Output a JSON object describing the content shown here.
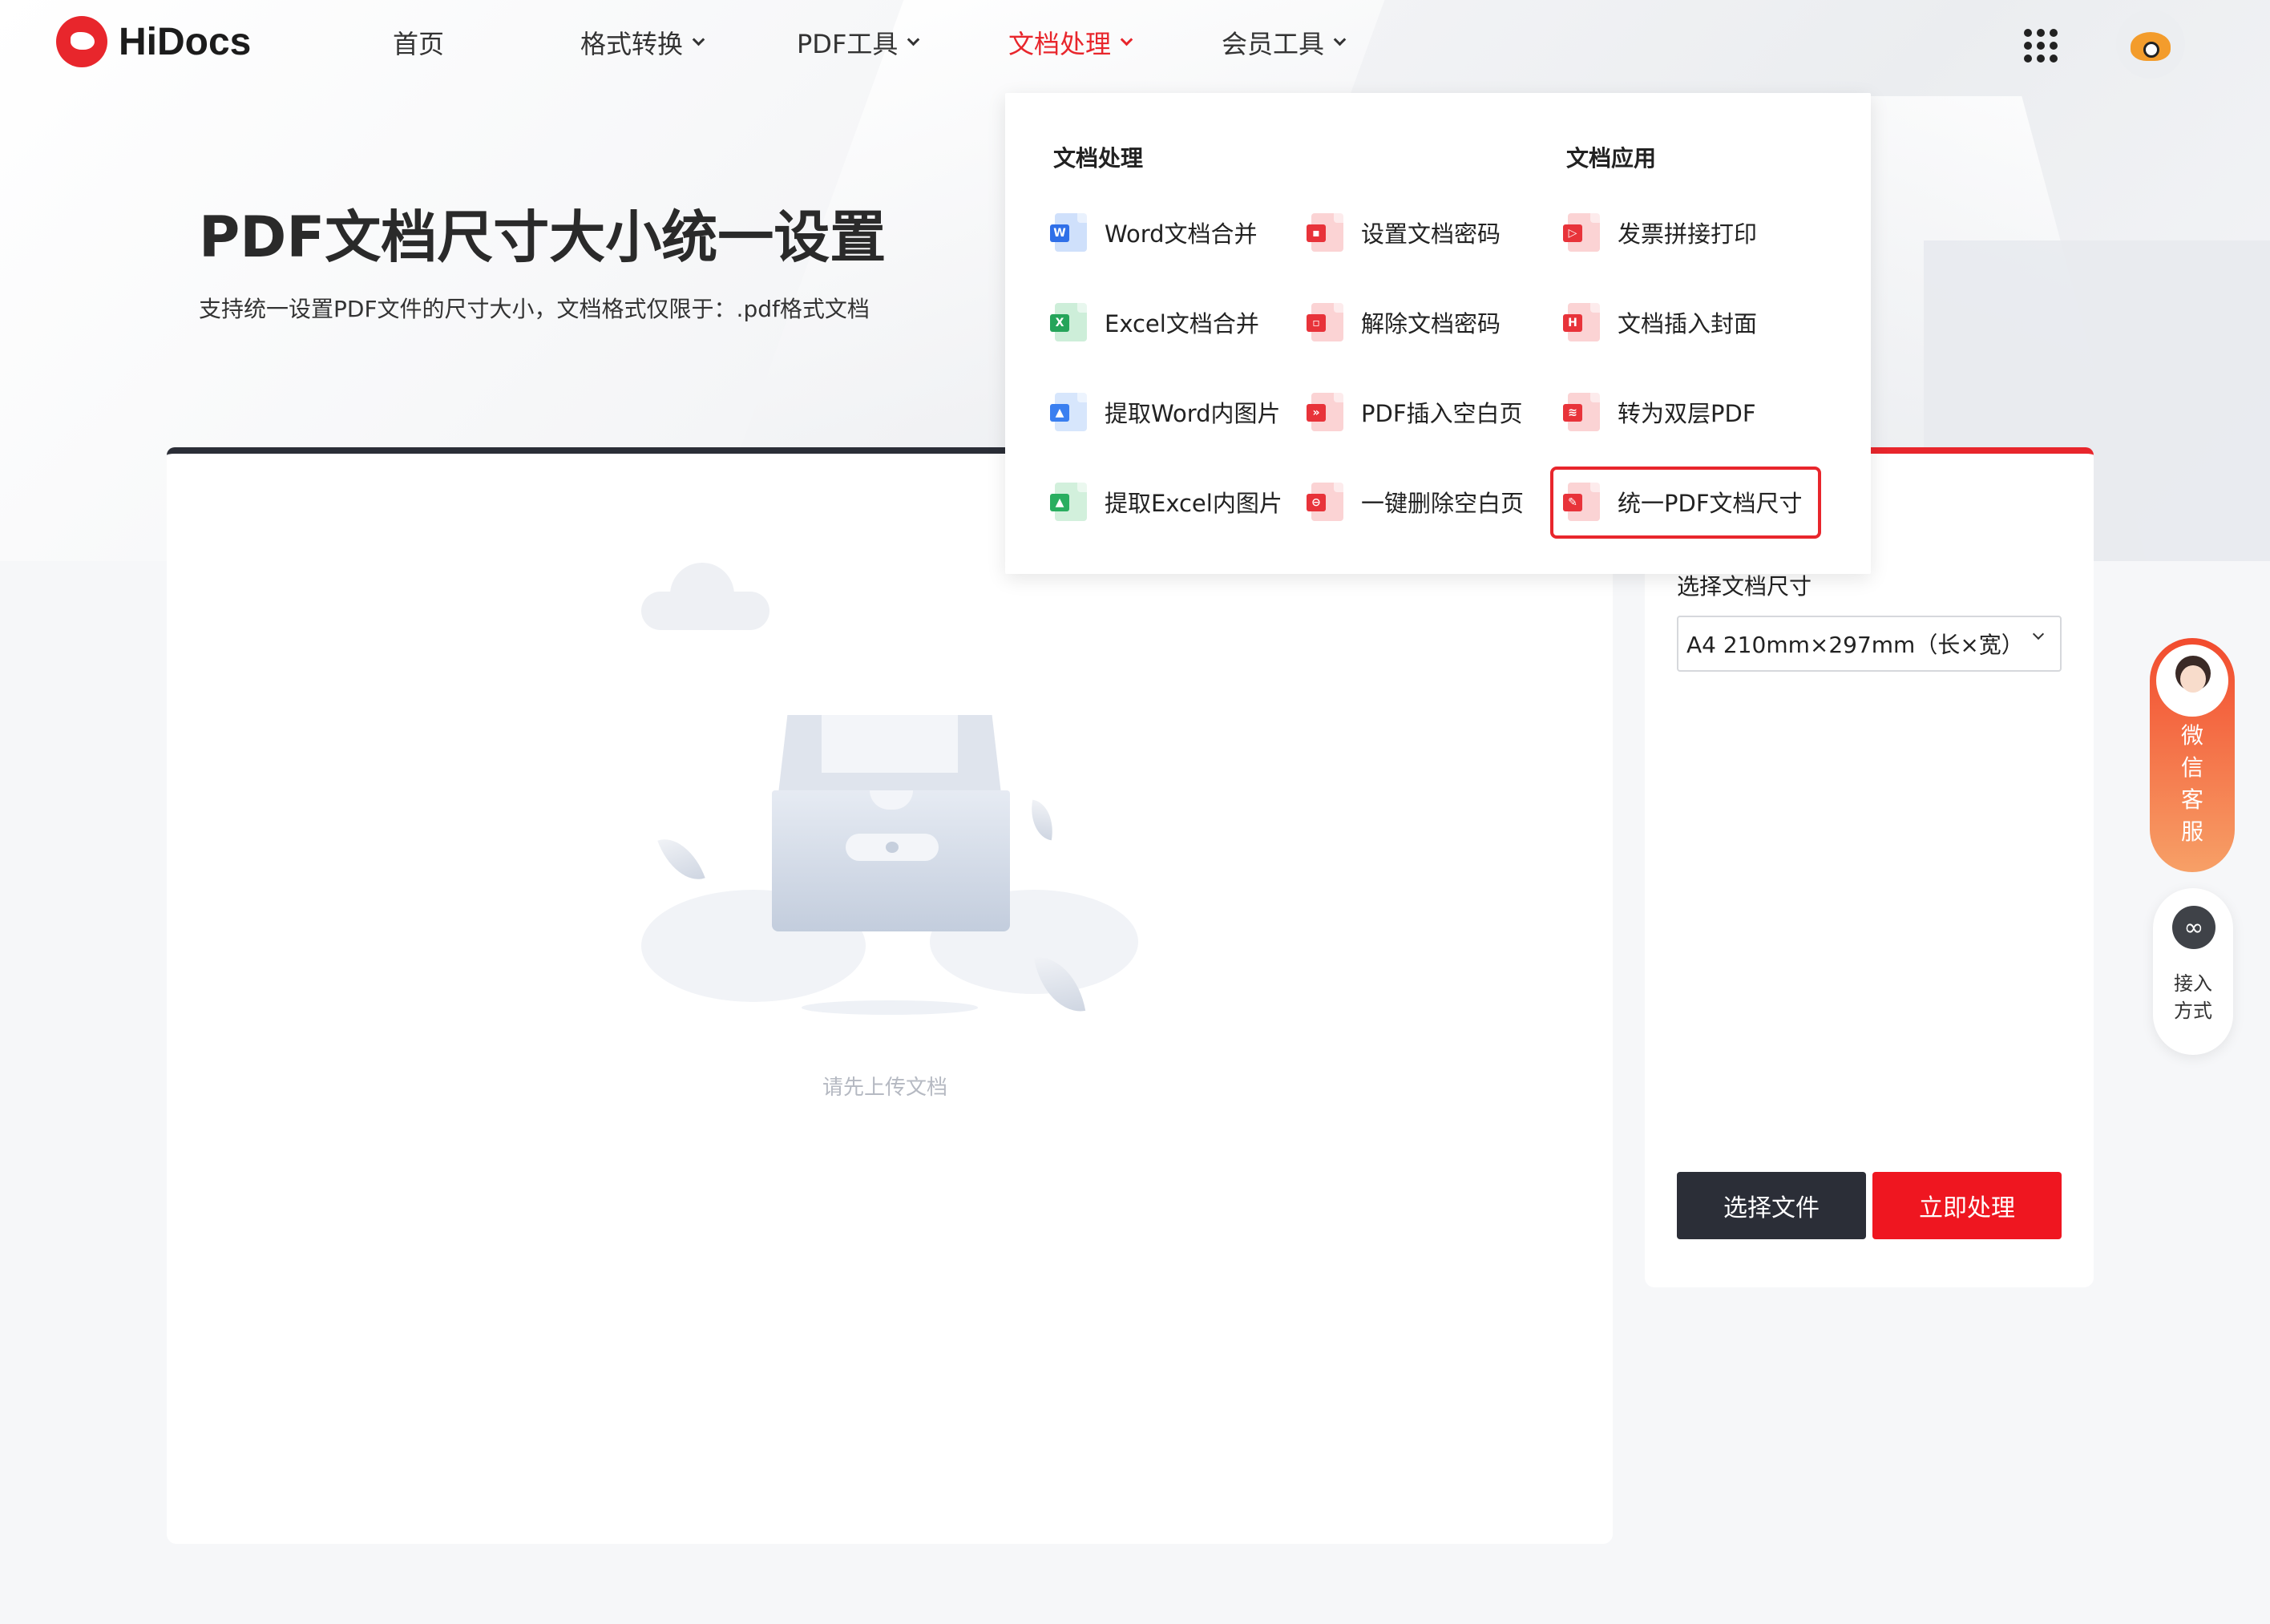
{
  "brand": {
    "name": "HiDocs",
    "color": "#e8262c"
  },
  "nav": {
    "items": [
      {
        "label": "首页",
        "has_dropdown": false
      },
      {
        "label": "格式转换",
        "has_dropdown": true
      },
      {
        "label": "PDF工具",
        "has_dropdown": true
      },
      {
        "label": "文档处理",
        "has_dropdown": true,
        "active": true
      },
      {
        "label": "会员工具",
        "has_dropdown": true
      }
    ],
    "apps_icon": "grid-apps-icon",
    "user_icon": "user-avatar-icon"
  },
  "hero": {
    "title": "PDF文档尺寸大小统一设置",
    "subtitle": "支持统一设置PDF文件的尺寸大小，文档格式仅限于：.pdf格式文档"
  },
  "dropdown": {
    "section_processing": "文档处理",
    "section_application": "文档应用",
    "col1": [
      {
        "label": "Word文档合并",
        "icon": "word-doc-icon",
        "glyph": "W"
      },
      {
        "label": "Excel文档合并",
        "icon": "excel-doc-icon",
        "glyph": "X"
      },
      {
        "label": "提取Word内图片",
        "icon": "word-image-icon",
        "glyph": "▲"
      },
      {
        "label": "提取Excel内图片",
        "icon": "excel-image-icon",
        "glyph": "▲"
      }
    ],
    "col2": [
      {
        "label": "设置文档密码",
        "icon": "lock-doc-icon",
        "glyph": "🔒"
      },
      {
        "label": "解除文档密码",
        "icon": "unlock-doc-icon",
        "glyph": "🔓"
      },
      {
        "label": "PDF插入空白页",
        "icon": "insert-page-icon",
        "glyph": "»"
      },
      {
        "label": "一键删除空白页",
        "icon": "delete-page-icon",
        "glyph": "⊖"
      }
    ],
    "col3": [
      {
        "label": "发票拼接打印",
        "icon": "invoice-doc-icon",
        "glyph": "▷"
      },
      {
        "label": "文档插入封面",
        "icon": "cover-doc-icon",
        "glyph": "H"
      },
      {
        "label": "转为双层PDF",
        "icon": "layers-doc-icon",
        "glyph": "≋"
      },
      {
        "label": "统一PDF文档尺寸",
        "icon": "resize-doc-icon",
        "glyph": "✎",
        "highlighted": true
      }
    ]
  },
  "upload_area": {
    "empty_text": "请先上传文档",
    "illustration": "empty-box-icon"
  },
  "side_panel": {
    "size_label": "选择文档尺寸",
    "size_value": "A4 210mm×297mm（长×宽）",
    "choose_button": "选择文件",
    "process_button": "立即处理"
  },
  "floating": {
    "service_lines": [
      "微",
      "信",
      "客",
      "服"
    ],
    "access_lines": [
      "接入",
      "方式"
    ]
  },
  "colors": {
    "accent_red": "#e8262c",
    "dark_button": "#2b2e37",
    "process_red": "#ef1620"
  }
}
